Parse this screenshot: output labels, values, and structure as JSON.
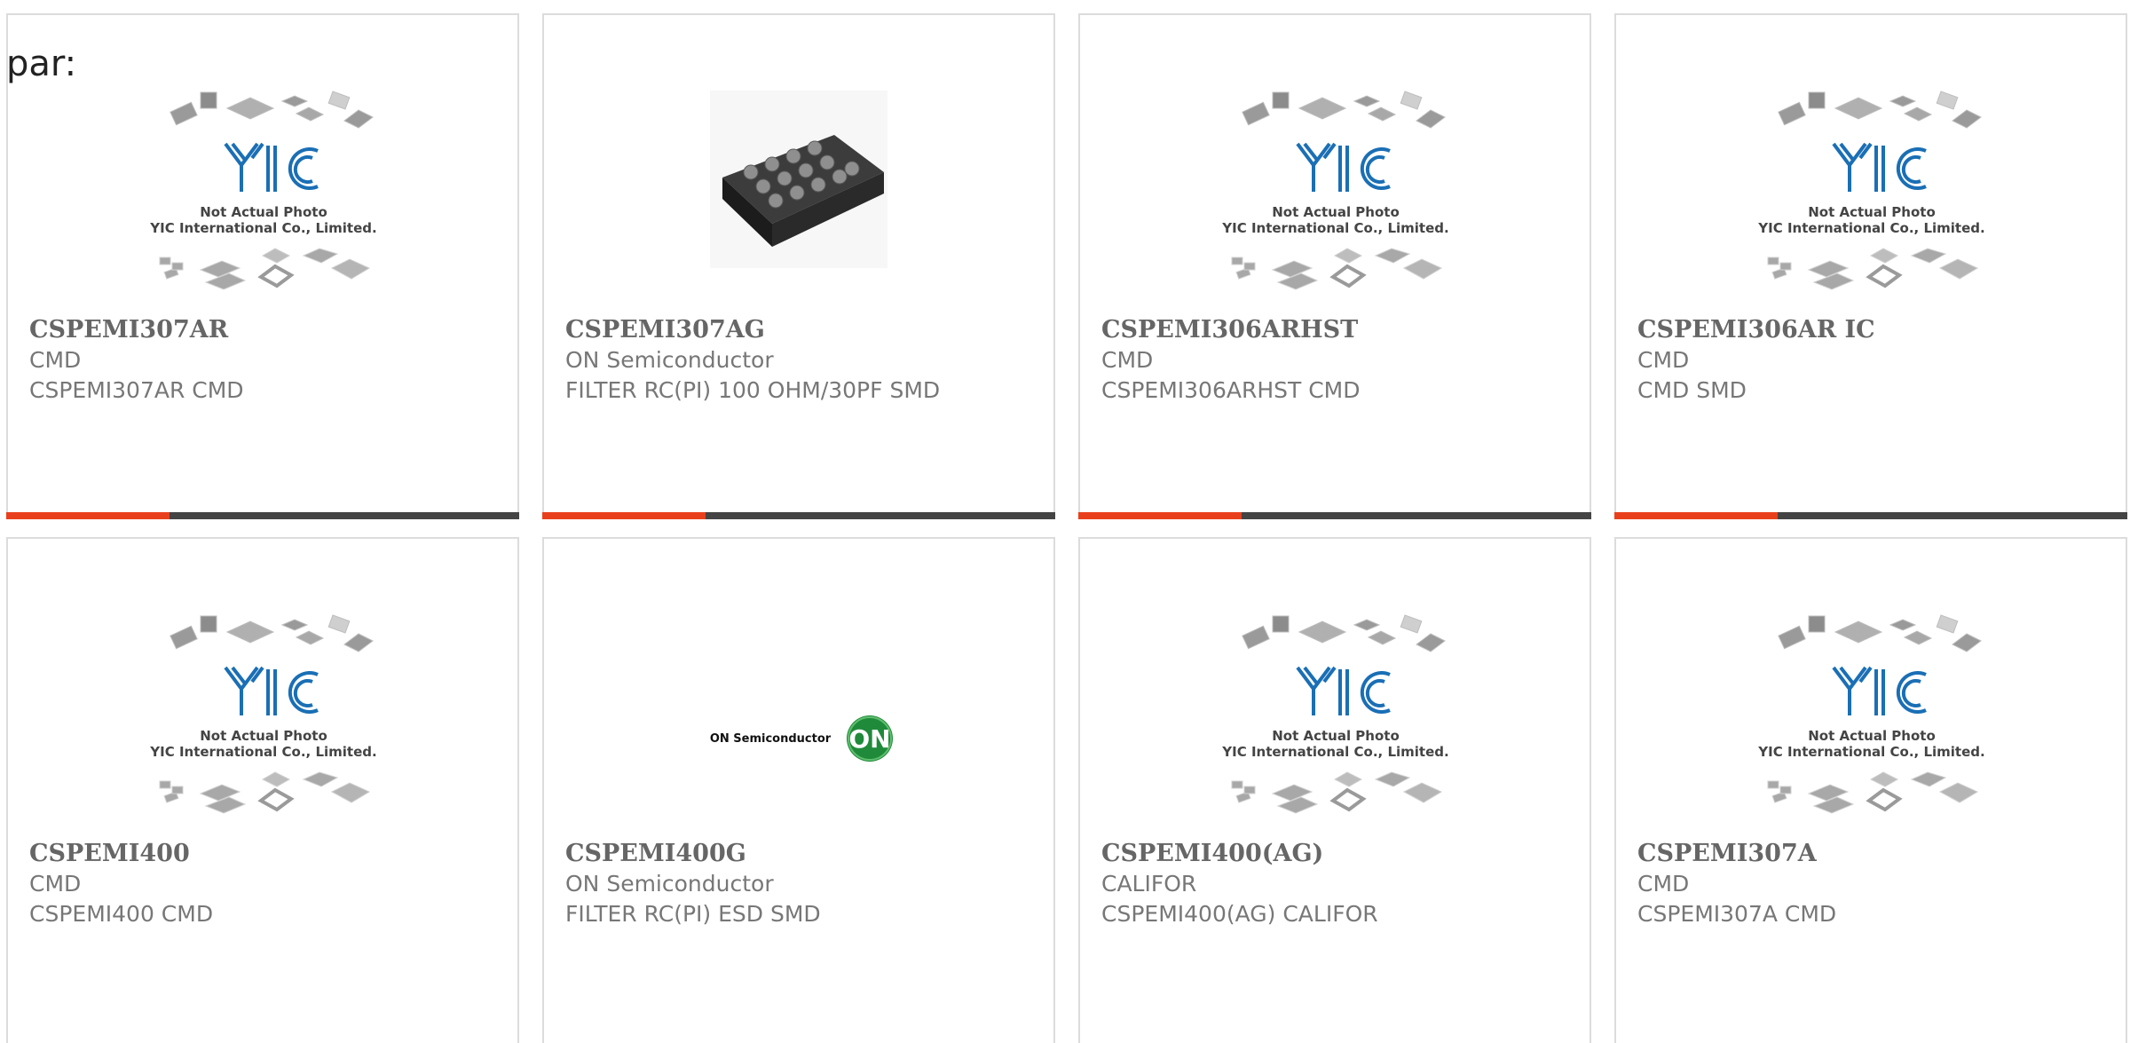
{
  "page": {
    "prefix_text": "par:"
  },
  "colors": {
    "accent": "#e8401c",
    "bar": "#444444",
    "border": "#dcdcdc",
    "logo_blue": "#1a6fb5",
    "on_green": "#1f8a3a"
  },
  "placeholder": {
    "caption_line1": "Not Actual Photo",
    "caption_line2": "YIC International Co., Limited.",
    "logo_text": "YIC"
  },
  "on_logo": {
    "wordmark": "ON Semiconductor",
    "badge": "ON"
  },
  "products": [
    {
      "part": "CSPEMI307AR",
      "manufacturer": "CMD",
      "description": "CSPEMI307AR CMD",
      "image": "placeholder"
    },
    {
      "part": "CSPEMI307AG",
      "manufacturer": "ON Semiconductor",
      "description": "FILTER RC(PI) 100 OHM/30PF SMD",
      "image": "chip-photo"
    },
    {
      "part": "CSPEMI306ARHST",
      "manufacturer": "CMD",
      "description": "CSPEMI306ARHST CMD",
      "image": "placeholder"
    },
    {
      "part": "CSPEMI306AR IC",
      "manufacturer": "CMD",
      "description": "CMD SMD",
      "image": "placeholder"
    },
    {
      "part": "CSPEMI400",
      "manufacturer": "CMD",
      "description": "CSPEMI400 CMD",
      "image": "placeholder"
    },
    {
      "part": "CSPEMI400G",
      "manufacturer": "ON Semiconductor",
      "description": "FILTER RC(PI) ESD SMD",
      "image": "on-logo"
    },
    {
      "part": "CSPEMI400(AG)",
      "manufacturer": "CALIFOR",
      "description": "CSPEMI400(AG) CALIFOR",
      "image": "placeholder"
    },
    {
      "part": "CSPEMI307A",
      "manufacturer": "CMD",
      "description": "CSPEMI307A CMD",
      "image": "placeholder"
    }
  ]
}
